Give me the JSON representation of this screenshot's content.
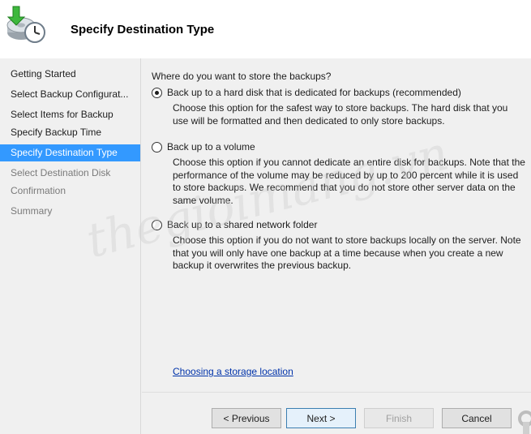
{
  "header": {
    "title": "Specify Destination Type",
    "icon": "backup-clock-icon"
  },
  "sidebar": {
    "steps": [
      {
        "label": "Getting Started",
        "state": "done"
      },
      {
        "label": "Select Backup Configurat...",
        "state": "done"
      },
      {
        "label": "Select Items for Backup",
        "state": "done"
      },
      {
        "label": "Specify Backup Time",
        "state": "done"
      },
      {
        "label": "Specify Destination Type",
        "state": "active"
      },
      {
        "label": "Select Destination Disk",
        "state": "pending"
      },
      {
        "label": "Confirmation",
        "state": "pending"
      },
      {
        "label": "Summary",
        "state": "pending"
      }
    ],
    "active_color": "#3399ff"
  },
  "main": {
    "question": "Where do you want to store the backups?",
    "options": [
      {
        "label": "Back up to a hard disk that is dedicated for backups (recommended)",
        "description": "Choose this option for the safest way to store backups. The hard disk that you use will be formatted and then dedicated to only store backups.",
        "selected": true
      },
      {
        "label": "Back up to a volume",
        "description": "Choose this option if you cannot dedicate an entire disk for backups. Note that the performance of the volume may be reduced by up to 200 percent while it is used to store backups. We recommend that you do not store other server data on the same volume.",
        "selected": false
      },
      {
        "label": "Back up to a shared network folder",
        "description": "Choose this option if you do not want to store backups locally on the server. Note that you will only have one backup at a time because when you create a new backup it overwrites the previous backup.",
        "selected": false
      }
    ],
    "link": "Choosing a storage location"
  },
  "watermark": "thegioimang.vn",
  "footer": {
    "previous": "< Previous",
    "next": "Next >",
    "finish": "Finish",
    "cancel": "Cancel"
  }
}
